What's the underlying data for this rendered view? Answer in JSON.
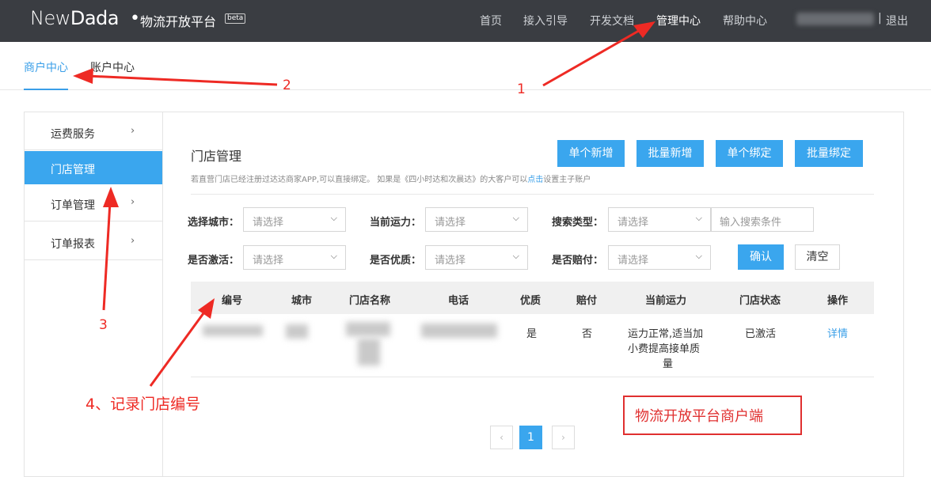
{
  "topbar": {
    "logo": {
      "part1": "New",
      "part2": "Dada"
    },
    "platform": "物流开放平台",
    "beta": "beta",
    "nav": [
      "首页",
      "接入引导",
      "开发文档",
      "管理中心",
      "帮助中心"
    ],
    "separator": "|",
    "logout": "退出"
  },
  "subnav": {
    "tabs": [
      "商户中心",
      "账户中心"
    ]
  },
  "sidebar": {
    "items": [
      "运费服务",
      "门店管理",
      "订单管理",
      "订单报表"
    ],
    "chevron": "›"
  },
  "main": {
    "title": "门店管理",
    "hint_prefix": "若直营门店已经注册过达达商家APP,可以直接绑定。 如果是《四小时达和次晨达》的大客户可以",
    "hint_link": "点击",
    "hint_suffix": "设置主子账户",
    "buttons": [
      "单个新增",
      "批量新增",
      "单个绑定",
      "批量绑定"
    ]
  },
  "filters": {
    "labels": [
      "选择城市：",
      "当前运力：",
      "搜索类型：",
      "是否激活：",
      "是否优质：",
      "是否赔付："
    ],
    "placeholder": "请选择",
    "arrow": "⌵",
    "search_placeholder": "输入搜索条件",
    "confirm": "确认",
    "clear": "清空"
  },
  "table": {
    "headers": [
      "编号",
      "城市",
      "门店名称",
      "电话",
      "优质",
      "赔付",
      "当前运力",
      "门店状态",
      "操作"
    ],
    "row": {
      "premium": "是",
      "compensation": "否",
      "capacity_line1": "运力正常,适当加",
      "capacity_line2": "小费提高接单质",
      "capacity_line3": "量",
      "status": "已激活",
      "action": "详情"
    }
  },
  "pagination": {
    "prev": "‹",
    "current": "1",
    "next": "›"
  },
  "annotations": {
    "n1": "1",
    "n2": "2",
    "n3": "3",
    "n4": "4、记录门店编号",
    "box": "物流开放平台商户端"
  },
  "colors": {
    "topbar": "#3a3d42",
    "accent": "#3aa6ee",
    "annotation": "#ee2a24"
  }
}
